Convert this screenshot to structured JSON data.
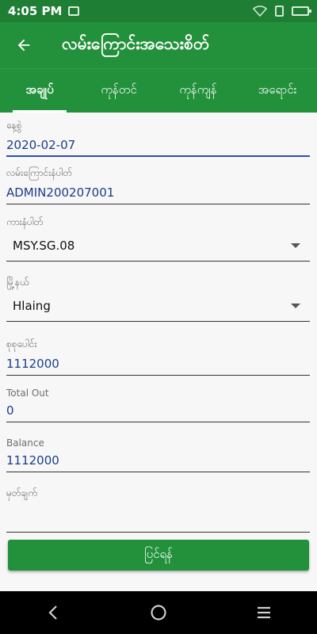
{
  "status_bar": {
    "time": "4:05 PM",
    "icons": [
      "gallery-icon",
      "wifi-icon",
      "sim-icon",
      "battery-icon"
    ]
  },
  "app_bar": {
    "title": "လမ်းကြောင်းအသေးစိတ်",
    "back_icon": "arrow-left-icon"
  },
  "tabs": [
    {
      "label": "အချုပ်",
      "active": true
    },
    {
      "label": "ကုန်တင်",
      "active": false
    },
    {
      "label": "ကုန်ကျန်",
      "active": false
    },
    {
      "label": "အရောင်း",
      "active": false
    }
  ],
  "form": {
    "date": {
      "label": "နေ့စွဲ",
      "value": "2020-02-07"
    },
    "route_no": {
      "label": "လမ်းကြောင်းနံပါတ်",
      "value": "ADMIN200207001"
    },
    "car_no": {
      "label": "ကားနံပါတ်",
      "value": "MSY.SG.08"
    },
    "township": {
      "label": "မြို့နယ်",
      "value": "Hlaing"
    },
    "total": {
      "label": "စုစုပေါင်း",
      "value": "1112000"
    },
    "total_out": {
      "label": "Total Out",
      "value": "0"
    },
    "balance": {
      "label": "Balance",
      "value": "1112000"
    },
    "remark": {
      "label": "မှတ်ချက်",
      "value": ""
    }
  },
  "save_button": {
    "label": "ပြင်ရန်"
  },
  "colors": {
    "primary": "#23913c",
    "status": "#1e7e34",
    "value_text": "#1a3c8c"
  }
}
